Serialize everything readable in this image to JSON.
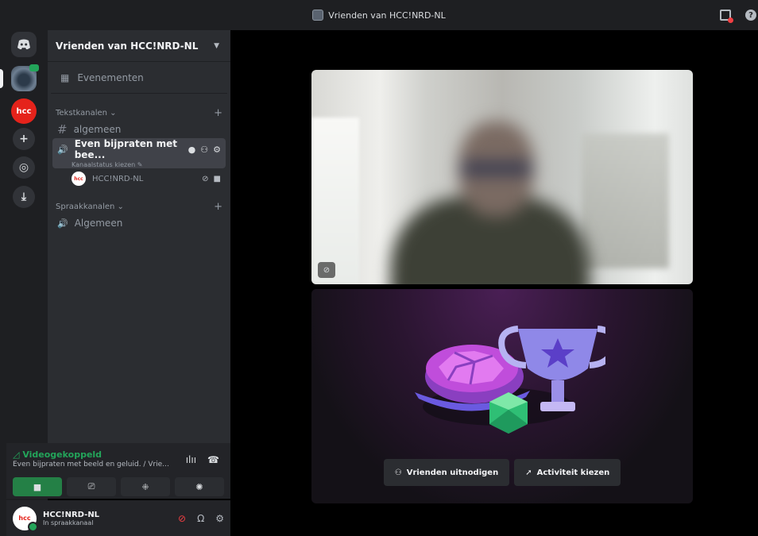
{
  "titlebar": {
    "title": "Vrienden van HCC!NRD-NL"
  },
  "rail": {
    "hcc_label": "hcc"
  },
  "guild": {
    "name": "Vrienden van HCC!NRD-NL",
    "events_label": "Evenementen",
    "text_category": "Tekstkanalen",
    "text_channels": [
      {
        "name": "algemeen"
      }
    ],
    "active_voice_channel": {
      "name": "Even bijpraten met bee...",
      "status": "Kanaalstatus kiezen"
    },
    "member": {
      "name": "HCC!NRD-NL",
      "avatar_label": "hcc"
    },
    "voice_category": "Spraakkanalen",
    "voice_channels": [
      {
        "name": "Algemeen"
      }
    ]
  },
  "voice_panel": {
    "status": "Videogekoppeld",
    "channel_info": "Even bijpraten met beeld en geluid. / Vrie..."
  },
  "user": {
    "name": "HCC!NRD-NL",
    "status": "In spraakkanaal",
    "avatar_label": "hcc"
  },
  "activity": {
    "invite_label": "Vrienden uitnodigen",
    "choose_activity_label": "Activiteit kiezen"
  },
  "colors": {
    "accent_green": "#23a55a",
    "danger_red": "#f23f43",
    "sidebar_bg": "#2b2d31",
    "rail_bg": "#1e1f22"
  }
}
